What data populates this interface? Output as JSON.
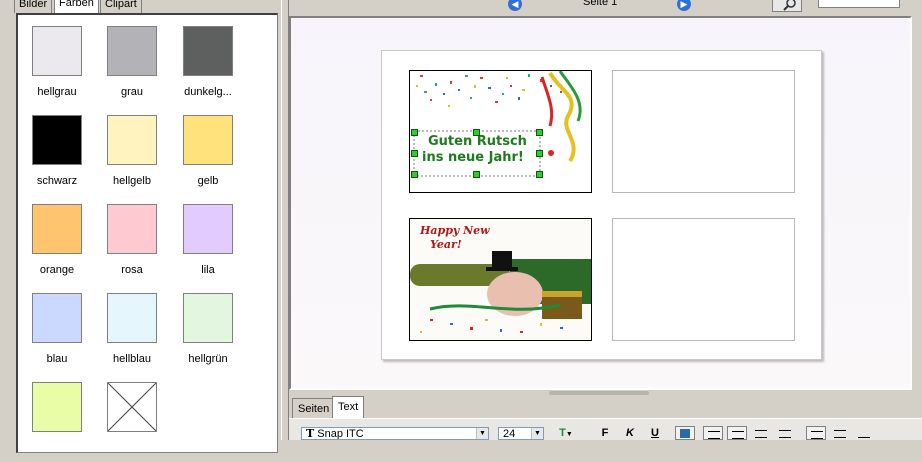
{
  "left_tabs": [
    "Bilder",
    "Farben",
    "Clipart"
  ],
  "swatches": [
    {
      "label": "hellgrau",
      "color": "#ebe8ee"
    },
    {
      "label": "grau",
      "color": "#b3b2b6"
    },
    {
      "label": "dunkelg...",
      "color": "#5e5f5f"
    },
    {
      "label": "schwarz",
      "color": "#000000"
    },
    {
      "label": "hellgelb",
      "color": "#fff4c0"
    },
    {
      "label": "gelb",
      "color": "#ffe27c"
    },
    {
      "label": "orange",
      "color": "#ffc46e"
    },
    {
      "label": "rosa",
      "color": "#ffc9d2"
    },
    {
      "label": "lila",
      "color": "#e2cbff"
    },
    {
      "label": "blau",
      "color": "#cbd8ff"
    },
    {
      "label": "hellblau",
      "color": "#e5f6fd"
    },
    {
      "label": "hellgrün",
      "color": "#e3f6df"
    },
    {
      "label": "",
      "color": "#e9fca6"
    },
    {
      "label": "",
      "color": "none"
    }
  ],
  "toolbar": {
    "page_label": "Seite 1",
    "prev_icon": "prev-page-icon",
    "next_icon": "next-page-icon",
    "zoom_icon": "magnifier-icon"
  },
  "preview": {
    "card1_text_line1": "Guten Rutsch",
    "card1_text_line2": "ins neue Jahr!",
    "card2_text_line1": "Happy New",
    "card2_text_line2": "Year!"
  },
  "bottom_tabs": [
    "Seiten",
    "Text"
  ],
  "text_toolbar": {
    "font": "Snap ITC",
    "size": "24",
    "bold_label": "F",
    "italic_label": "K",
    "underline_label": "U"
  }
}
